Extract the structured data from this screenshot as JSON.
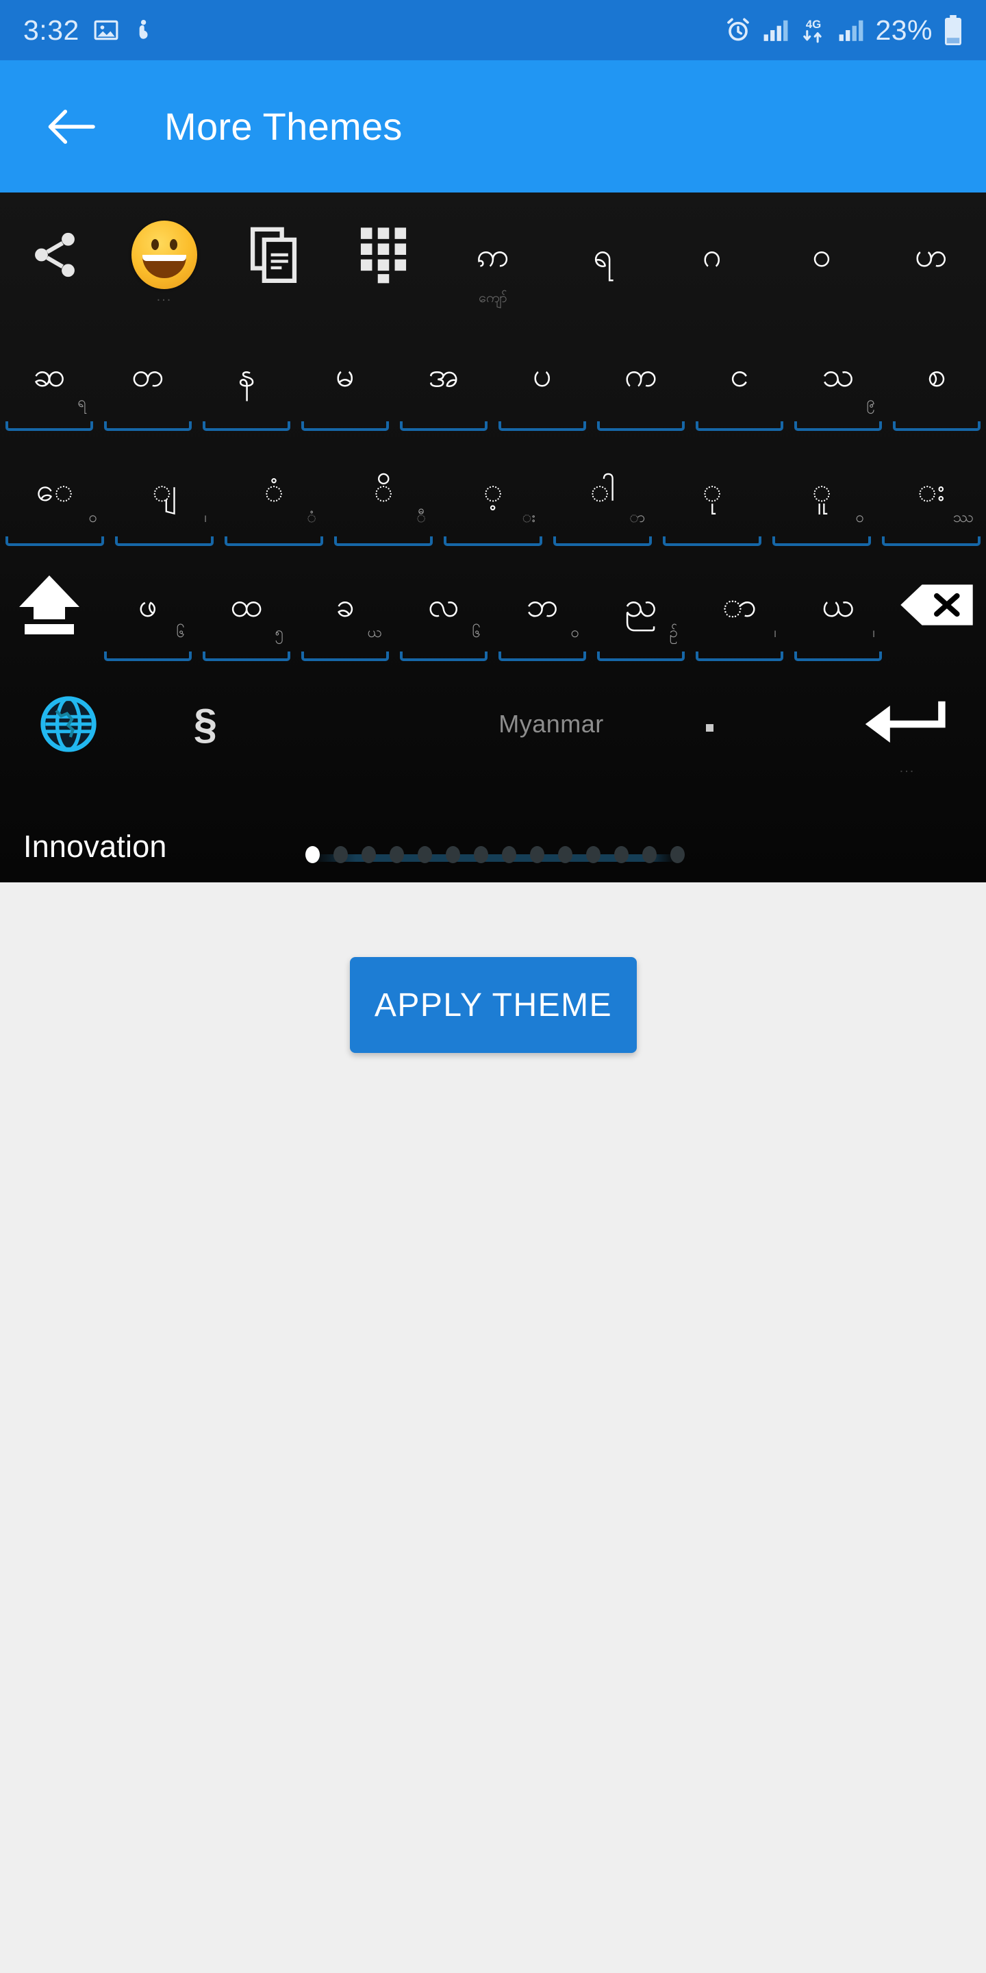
{
  "status_bar": {
    "time": "3:32",
    "battery_percent": "23%",
    "network_type": "4G",
    "background": "#1A76D2",
    "icons": [
      "image-icon",
      "pregnant-woman-icon",
      "alarm-icon",
      "signal-bars-icon",
      "4g-data-icon",
      "signal-bars-2-icon",
      "battery-icon"
    ]
  },
  "app_bar": {
    "title": "More Themes",
    "back_label": "back-arrow",
    "background": "#2196F3"
  },
  "keyboard_preview": {
    "background": "#0A0A0A",
    "language_label": "Myanmar",
    "watermark": "Innovation",
    "section_symbol": "§",
    "rows": {
      "top": [
        {
          "name": "share-key",
          "glyph": "share-icon",
          "type": "icon"
        },
        {
          "name": "emoji-key",
          "glyph": "emoji-icon",
          "type": "icon",
          "hint": "..."
        },
        {
          "name": "clipboard-key",
          "glyph": "clipboard-icon",
          "type": "icon"
        },
        {
          "name": "numpad-key",
          "glyph": "numpad-icon",
          "type": "icon"
        },
        {
          "name": "key-ka",
          "glyph": "ဢ",
          "type": "char",
          "sub": "ကျော်"
        },
        {
          "name": "key-ya",
          "glyph": "ရ",
          "type": "char"
        },
        {
          "name": "key-na",
          "glyph": "ဂ",
          "type": "char"
        },
        {
          "name": "key-wa",
          "glyph": "ဝ",
          "type": "char"
        },
        {
          "name": "key-tha",
          "glyph": "ဟ",
          "type": "char"
        }
      ],
      "second": [
        {
          "name": "key-hsa",
          "glyph": "ဆ",
          "hint": "ရ"
        },
        {
          "name": "key-ta",
          "glyph": "တ"
        },
        {
          "name": "key-na2",
          "glyph": "န"
        },
        {
          "name": "key-ma",
          "glyph": "မ"
        },
        {
          "name": "key-a",
          "glyph": "အ"
        },
        {
          "name": "key-pa",
          "glyph": "ပ"
        },
        {
          "name": "key-ka2",
          "glyph": "က"
        },
        {
          "name": "key-nga",
          "glyph": "င"
        },
        {
          "name": "key-tha2",
          "glyph": "သ",
          "hint": "၉"
        },
        {
          "name": "key-sa",
          "glyph": "စ"
        }
      ],
      "third": [
        {
          "name": "key-vowel-e",
          "glyph": "ေ",
          "hint": "၀"
        },
        {
          "name": "key-vowel-ya",
          "glyph": "ျ",
          "hint": "၊"
        },
        {
          "name": "key-anusvara",
          "glyph": "ံ",
          "hint": "ံ"
        },
        {
          "name": "key-vowel-i",
          "glyph": "ိ",
          "hint": "ီ"
        },
        {
          "name": "key-dot-below",
          "glyph": "့",
          "hint": "း"
        },
        {
          "name": "key-vowel-aa",
          "glyph": "ါ",
          "hint": "ာ"
        },
        {
          "name": "key-vowel-u",
          "glyph": "ု",
          "hint": ""
        },
        {
          "name": "key-vowel-uu",
          "glyph": "ူ",
          "hint": "၀"
        },
        {
          "name": "key-visarga",
          "glyph": "း",
          "hint": "ဿ"
        }
      ],
      "fourth": [
        {
          "name": "shift-key",
          "glyph": "shift-icon",
          "type": "icon"
        },
        {
          "name": "key-pha",
          "glyph": "ဖ",
          "hint": "၆"
        },
        {
          "name": "key-hta",
          "glyph": "ထ",
          "hint": "၅"
        },
        {
          "name": "key-kha",
          "glyph": "ခ",
          "hint": "ယ"
        },
        {
          "name": "key-la",
          "glyph": "လ",
          "hint": "၆"
        },
        {
          "name": "key-ba",
          "glyph": "ဘ",
          "hint": "၀"
        },
        {
          "name": "key-nya",
          "glyph": "ည",
          "hint": "ဉ်"
        },
        {
          "name": "key-da",
          "glyph": "ာ",
          "hint": "၊"
        },
        {
          "name": "key-wa2",
          "glyph": "ယ",
          "hint": "၊"
        },
        {
          "name": "backspace-key",
          "glyph": "backspace-icon",
          "type": "icon"
        }
      ],
      "bottom": [
        {
          "name": "language-globe-key",
          "glyph": "globe-icon",
          "type": "icon"
        },
        {
          "name": "symbols-key",
          "glyph": "§",
          "type": "char"
        },
        {
          "name": "space-key",
          "glyph": "Myanmar",
          "type": "space"
        },
        {
          "name": "enter-key",
          "glyph": "enter-icon",
          "type": "icon"
        }
      ]
    },
    "page_indicator": {
      "total": 14,
      "active_index": 0
    }
  },
  "content": {
    "apply_button": {
      "label": "APPLY THEME",
      "color": "#1D7DD4"
    },
    "background": "#EFEFEF"
  }
}
